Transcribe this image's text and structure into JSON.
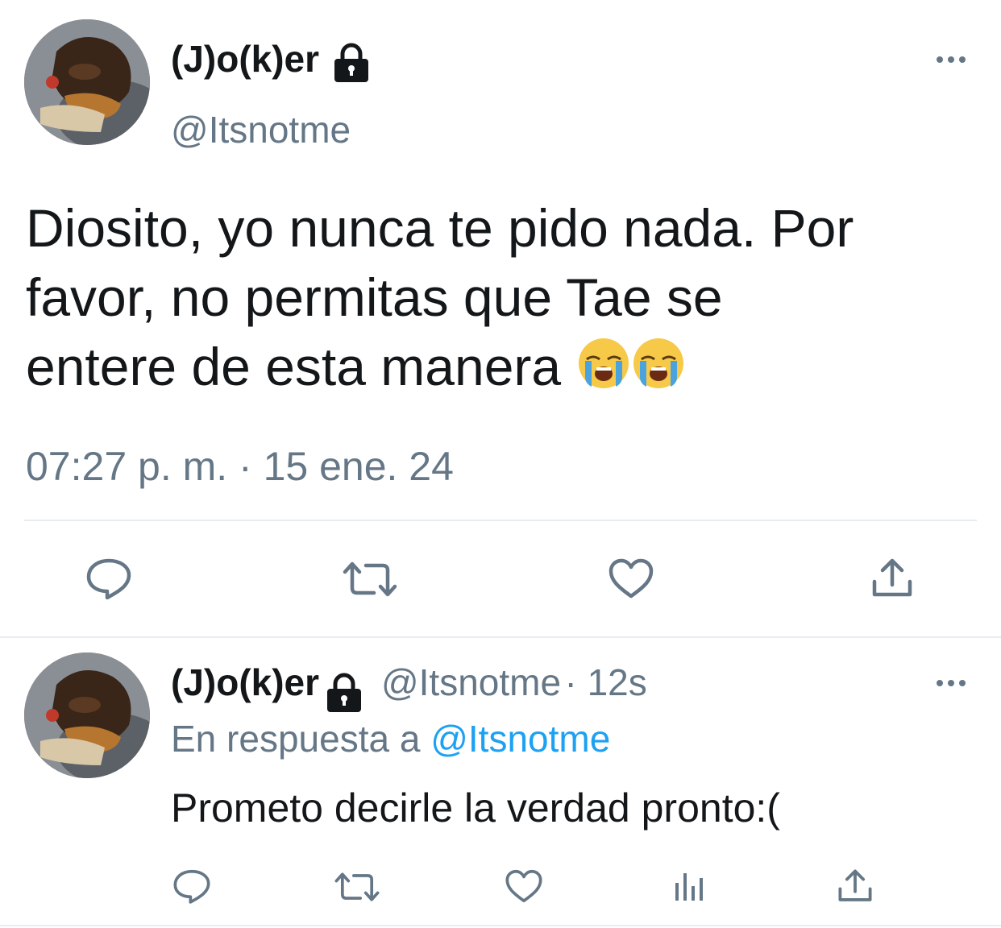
{
  "main_tweet": {
    "author_name": "(J)o(k)er",
    "handle": "@Itsnotme",
    "lines": [
      "Diosito, yo nunca te pido nada. Por",
      "favor, no permitas que Tae se",
      "entere de esta manera"
    ],
    "emoji": [
      "😭",
      "😭"
    ],
    "timestamp": "07:27 p. m. · 15 ene. 24"
  },
  "reply_tweet": {
    "author_name": "(J)o(k)er",
    "handle": "@Itsnotme",
    "time_ago": "· 12s",
    "replying_prefix": "En respuesta a",
    "replying_handle": "@Itsnotme",
    "text": "Prometo decirle la verdad pronto:("
  },
  "icons": {
    "lock": "lock-icon",
    "more": "more-options-icon",
    "reply": "reply-icon",
    "retweet": "retweet-icon",
    "like": "like-icon",
    "share": "share-icon",
    "analytics": "analytics-icon"
  },
  "colors": {
    "text": "#14171a",
    "secondary": "#657786",
    "link": "#1da1f2",
    "divider": "#e6ecf0"
  }
}
